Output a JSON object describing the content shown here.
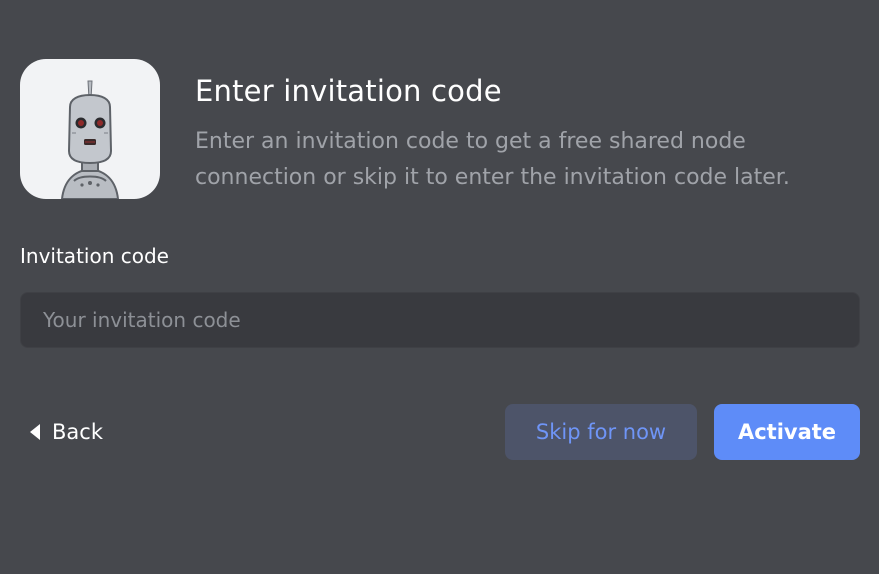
{
  "header": {
    "title": "Enter invitation code",
    "description": "Enter an invitation code to get a free shared node connection or skip it to enter the invitation code later.",
    "avatar_icon": "robot-mascot-icon"
  },
  "form": {
    "label": "Invitation code",
    "value": "",
    "placeholder": "Your invitation code"
  },
  "actions": {
    "back_label": "Back",
    "back_icon": "caret-left-icon",
    "skip_label": "Skip for now",
    "activate_label": "Activate"
  },
  "colors": {
    "background": "#46484d",
    "input_background": "#393a3f",
    "primary": "#5e8cf8",
    "secondary_button_bg": "#4d5469",
    "secondary_button_text": "#6f95f7",
    "muted_text": "#a0a3a9"
  }
}
